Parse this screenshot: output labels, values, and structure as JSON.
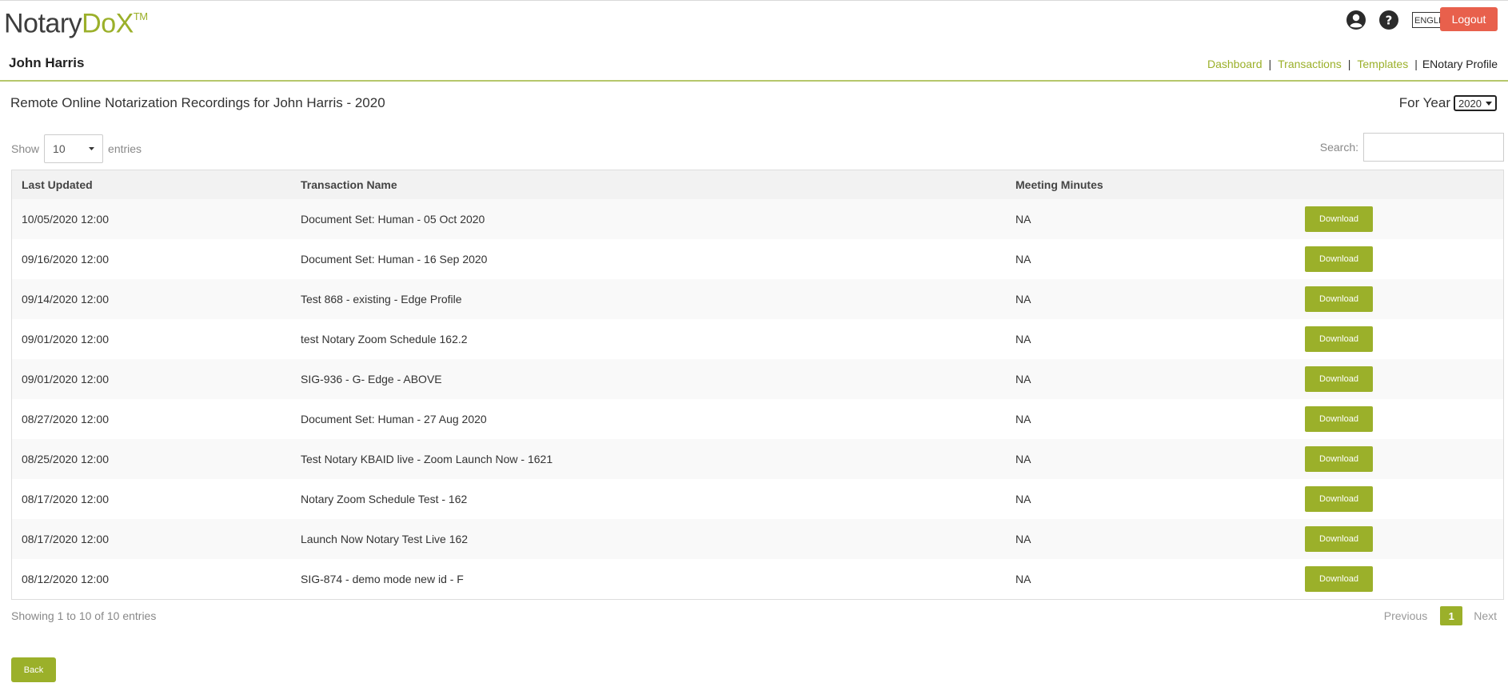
{
  "app": {
    "logo_part1": "Notary",
    "logo_part2": "DoX",
    "logo_tm": "TM"
  },
  "header": {
    "language": "ENGLISH",
    "logout_label": "Logout",
    "icons": [
      "user-circle-icon",
      "help-circle-icon"
    ]
  },
  "user": {
    "name": "John Harris"
  },
  "nav": {
    "items": [
      {
        "label": "Dashboard"
      },
      {
        "label": "Transactions"
      },
      {
        "label": "Templates"
      }
    ],
    "current": "ENotary Profile"
  },
  "page": {
    "title": "Remote Online Notarization Recordings for John Harris - 2020",
    "year_label": "For Year",
    "year_value": "2020"
  },
  "controls": {
    "show_label": "Show",
    "entries_value": "10",
    "entries_label": "entries",
    "search_label": "Search:",
    "search_value": ""
  },
  "table": {
    "headers": [
      "Last Updated",
      "Transaction Name",
      "Meeting Minutes",
      ""
    ],
    "download_label": "Download",
    "rows": [
      {
        "updated": "10/05/2020 12:00",
        "name": "Document Set: Human - 05 Oct 2020",
        "minutes": "NA"
      },
      {
        "updated": "09/16/2020 12:00",
        "name": "Document Set: Human - 16 Sep 2020",
        "minutes": "NA"
      },
      {
        "updated": "09/14/2020 12:00",
        "name": "Test 868 - existing - Edge Profile",
        "minutes": "NA"
      },
      {
        "updated": "09/01/2020 12:00",
        "name": "test Notary Zoom Schedule 162.2",
        "minutes": "NA"
      },
      {
        "updated": "09/01/2020 12:00",
        "name": "SIG-936 - G- Edge - ABOVE",
        "minutes": "NA"
      },
      {
        "updated": "08/27/2020 12:00",
        "name": "Document Set: Human - 27 Aug 2020",
        "minutes": "NA"
      },
      {
        "updated": "08/25/2020 12:00",
        "name": "Test Notary KBAID live - Zoom Launch Now - 1621",
        "minutes": "NA"
      },
      {
        "updated": "08/17/2020 12:00",
        "name": "Notary Zoom Schedule Test - 162",
        "minutes": "NA"
      },
      {
        "updated": "08/17/2020 12:00",
        "name": "Launch Now Notary Test Live 162",
        "minutes": "NA"
      },
      {
        "updated": "08/12/2020 12:00",
        "name": "SIG-874 - demo mode new id - F",
        "minutes": "NA"
      }
    ]
  },
  "footer": {
    "info": "Showing 1 to 10 of 10 entries",
    "prev": "Previous",
    "page": "1",
    "next": "Next",
    "back_label": "Back"
  },
  "colors": {
    "brand_green": "#9bb02a",
    "logout_red": "#e8604c"
  }
}
